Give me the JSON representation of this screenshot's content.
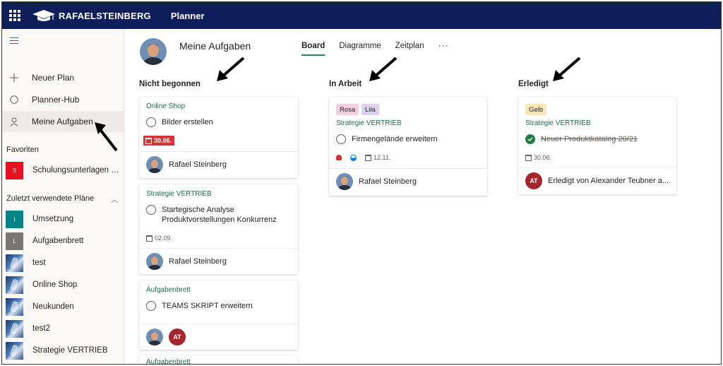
{
  "topbar": {
    "brand": "RAFAELSTEINBERG",
    "app": "Planner"
  },
  "sidebar": {
    "nav": [
      {
        "label": "Neuer Plan",
        "icon": "plus-icon"
      },
      {
        "label": "Planner-Hub",
        "icon": "hub-circle-icon"
      },
      {
        "label": "Meine Aufgaben",
        "icon": "person-icon",
        "active": true
      }
    ],
    "favorites_label": "Favoriten",
    "favorites": [
      {
        "label": "Schulungsunterlagen Pl...",
        "tile_letter": "S",
        "tile_color": "#e81123"
      }
    ],
    "recent_label": "Zuletzt verwendete Pläne",
    "recent": [
      {
        "label": "Umsetzung",
        "tile_letter": "I",
        "tile_color": "#038387",
        "image": false
      },
      {
        "label": "Aufgabenbrett",
        "tile_letter": "L",
        "tile_color": "#7a7574",
        "image": false
      },
      {
        "label": "test",
        "image": true
      },
      {
        "label": "Online Shop",
        "image": true
      },
      {
        "label": "Neukunden",
        "image": true
      },
      {
        "label": "test2",
        "image": true
      },
      {
        "label": "Strategie VERTRIEB",
        "image": true
      }
    ]
  },
  "header": {
    "title": "Meine Aufgaben",
    "tabs": [
      {
        "label": "Board",
        "active": true
      },
      {
        "label": "Diagramme",
        "active": false
      },
      {
        "label": "Zeitplan",
        "active": false
      }
    ],
    "more": "···"
  },
  "columns": [
    {
      "title": "Nicht begonnen"
    },
    {
      "title": "In Arbeit"
    },
    {
      "title": "Erledigt"
    }
  ],
  "cards": {
    "c1": {
      "plan": "Online Shop",
      "task": "Bilder erstellen",
      "due": "30.06.",
      "assignee": "Rafael Steinberg"
    },
    "c2": {
      "plan": "Strategie VERTRIEB",
      "task": "Startegische Analyse Produktvorstellungen Konkurrenz",
      "due": "02.09.",
      "assignee": "Rafael Steinberg"
    },
    "c3": {
      "plan": "Aufgabenbrett",
      "task": "TEAMS SKRIPT erweitern",
      "assignee_initials": "AT"
    },
    "c4": {
      "plan": "Aufgabenbrett"
    },
    "c5": {
      "tags": [
        "Rosa",
        "Lila"
      ],
      "tag_colors": [
        "#f4cfe0",
        "#ddd1ee"
      ],
      "plan": "Strategie VERTRIEB",
      "task": "Firmengelände erweitern",
      "due": "12.11.",
      "assignee": "Rafael Steinberg"
    },
    "c6": {
      "tags": [
        "Gelb"
      ],
      "tag_colors": [
        "#f9e8b6"
      ],
      "plan": "Strategie VERTRIEB",
      "task": "Neuer Produktkatalog 20/21",
      "due": "30.06.",
      "completed_by": "Erledigt von Alexander Teubner a...",
      "completed_initials": "AT"
    }
  },
  "colors": {
    "topbar": "#0e1e5b",
    "accent": "#2e7d60",
    "overdue": "#d13438",
    "complete": "#237b4b"
  }
}
